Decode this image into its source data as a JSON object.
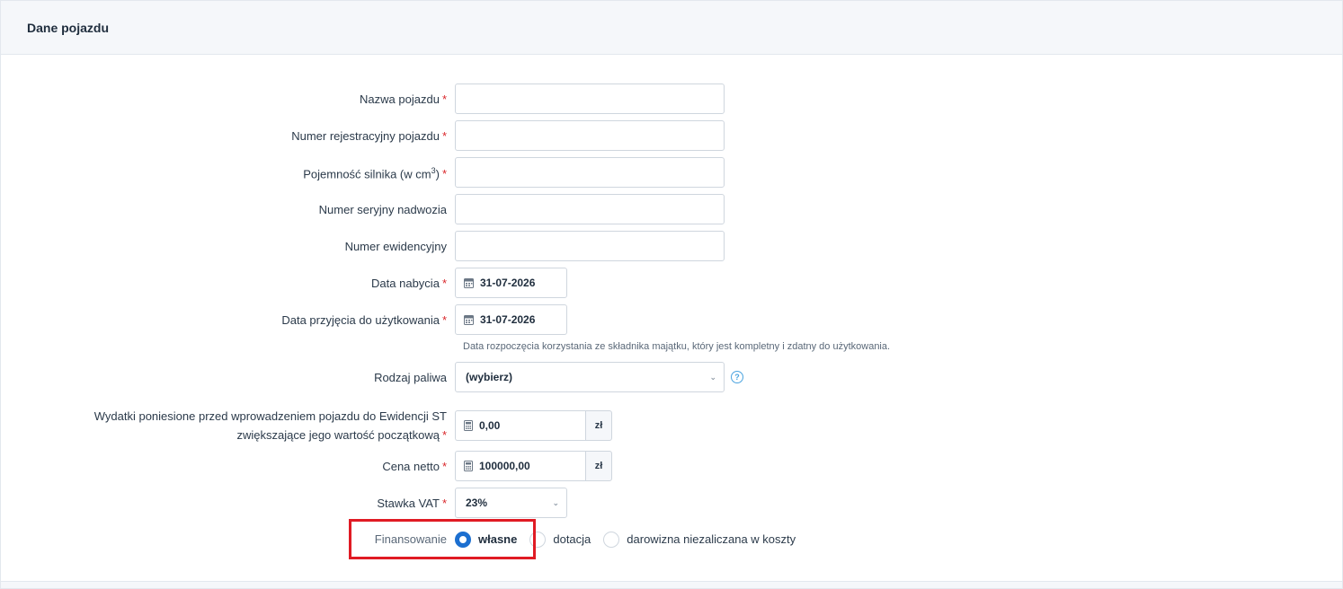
{
  "panel": {
    "title": "Dane pojazdu"
  },
  "fields": {
    "nazwa": {
      "label": "Nazwa pojazdu",
      "required_mark": "*",
      "value": ""
    },
    "rejestracja": {
      "label": "Numer rejestracyjny pojazdu",
      "required_mark": "*",
      "value": ""
    },
    "pojemnosc": {
      "label": "Pojemność silnika (w cm",
      "sup": "3",
      "label_end": ")",
      "required_mark": "*",
      "value": ""
    },
    "nadwozie": {
      "label": "Numer seryjny nadwozia",
      "value": ""
    },
    "ewidencyjny": {
      "label": "Numer ewidencyjny",
      "value": ""
    },
    "data_nabycia": {
      "label": "Data nabycia",
      "required_mark": "*",
      "value": "31-07-2026",
      "icon": "calendar-icon"
    },
    "data_przyjecia": {
      "label": "Data przyjęcia do użytkowania",
      "required_mark": "*",
      "value": "31-07-2026",
      "icon": "calendar-icon",
      "hint": "Data rozpoczęcia korzystania ze składnika majątku, który jest kompletny i zdatny do użytkowania."
    },
    "paliwo": {
      "label": "Rodzaj paliwa",
      "value": "(wybierz)",
      "help_icon": "?"
    },
    "wydatki": {
      "label_line1": "Wydatki poniesione przed wprowadzeniem pojazdu do Ewidencji ST",
      "label_line2": "zwiększające jego wartość początkową",
      "required_mark": "*",
      "value": "0,00",
      "unit": "zł",
      "icon": "calculator-icon"
    },
    "cena": {
      "label": "Cena netto",
      "required_mark": "*",
      "value": "100000,00",
      "unit": "zł",
      "icon": "calculator-icon"
    },
    "vat": {
      "label": "Stawka VAT",
      "required_mark": "*",
      "value": "23%"
    },
    "finansowanie": {
      "label": "Finansowanie",
      "options": [
        {
          "label": "własne",
          "checked": true
        },
        {
          "label": "dotacja",
          "checked": false
        },
        {
          "label": "darowizna niezaliczana w koszty",
          "checked": false
        }
      ]
    }
  },
  "colors": {
    "accent": "#1c6fd0",
    "required": "#d9262a",
    "highlight": "#e01b24"
  }
}
